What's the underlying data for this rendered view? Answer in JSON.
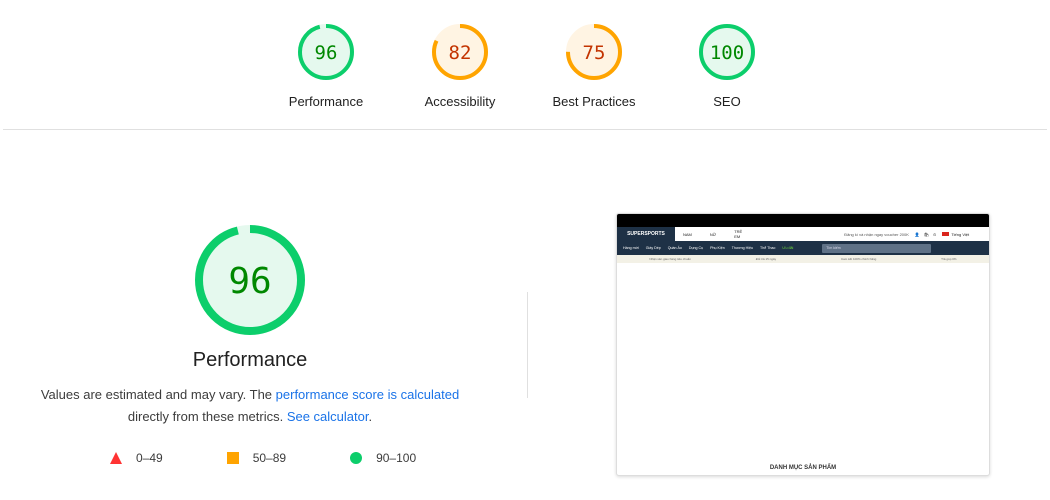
{
  "scores": [
    {
      "label": "Performance",
      "score": 96,
      "rating": "pass"
    },
    {
      "label": "Accessibility",
      "score": 82,
      "rating": "average"
    },
    {
      "label": "Best Practices",
      "score": 75,
      "rating": "average"
    },
    {
      "label": "SEO",
      "score": 100,
      "rating": "pass"
    }
  ],
  "main": {
    "score": 96,
    "title": "Performance",
    "desc_prefix": "Values are estimated and may vary. The ",
    "desc_link": "performance score is calculated",
    "desc_mid": "directly from these metrics. ",
    "desc_link2": "See calculator",
    "desc_end": "."
  },
  "legend": [
    {
      "icon": "triangle-icon",
      "range": "0–49"
    },
    {
      "icon": "square-icon",
      "range": "50–89"
    },
    {
      "icon": "circle-icon",
      "range": "90–100"
    }
  ],
  "colors": {
    "pass": "#0cce6b",
    "pass_text": "#008800",
    "average": "#ffa400",
    "average_text": "#c33300",
    "fail": "#ff3333"
  },
  "screenshot": {
    "logo": "SUPERSPORTS",
    "top_tabs": [
      "NAM",
      "NỮ",
      "TRẺ EM"
    ],
    "voucher": "Đăng kí và nhận ngay voucher 200K",
    "language": "Tiếng Việt",
    "nav": [
      "Hàng mới",
      "Giày Dép",
      "Quần Áo",
      "Dụng Cụ",
      "Phụ Kiện",
      "Thương Hiệu",
      "Thể Thao",
      "Ưu đãi"
    ],
    "search": "Tìm kiếm",
    "promos": [
      "Nhận sản giao hàng tiêu chuẩn",
      "Đổi trả 15 ngày",
      "Cam kết 100% chính hãng",
      "Trả góp 0%"
    ],
    "category": "DANH MỤC SẢN PHẨM"
  }
}
